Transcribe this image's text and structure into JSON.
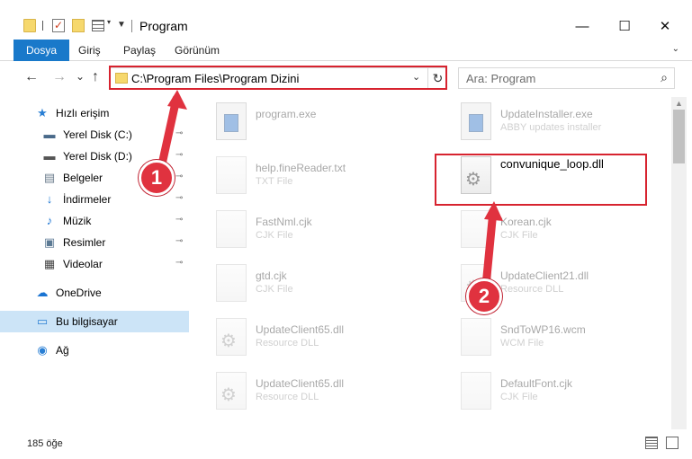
{
  "window": {
    "title": "Program",
    "minimize": "—",
    "maximize": "☐",
    "close": "✕"
  },
  "ribbon": {
    "tabs": [
      "Dosya",
      "Giriş",
      "Paylaş",
      "Görünüm"
    ],
    "expand_icon": "chevron-down-icon"
  },
  "nav": {
    "back": "←",
    "forward": "→",
    "recent": "⌄",
    "up": "↑",
    "address": "C:\\Program Files\\Program Dizini",
    "address_drop": "⌄",
    "refresh": "↻",
    "search_placeholder": "Ara: Program",
    "search_icon": "⌕"
  },
  "sidebar": {
    "items": [
      {
        "label": "Hızlı erişim",
        "icon": "★",
        "color": "#2a7fd4"
      },
      {
        "label": "Yerel Disk (C:)",
        "icon": "▬",
        "color": "#4a6a8a",
        "pinned": true
      },
      {
        "label": "Yerel Disk (D:)",
        "icon": "▬",
        "color": "#555555",
        "pinned": true
      },
      {
        "label": "Belgeler",
        "icon": "▤",
        "color": "#6b7c8c",
        "pinned": true
      },
      {
        "label": "İndirmeler",
        "icon": "↓",
        "color": "#1a74d2",
        "pinned": true
      },
      {
        "label": "Müzik",
        "icon": "♪",
        "color": "#1a74d2",
        "pinned": true
      },
      {
        "label": "Resimler",
        "icon": "▣",
        "color": "#5c7a94",
        "pinned": true
      },
      {
        "label": "Videolar",
        "icon": "▦",
        "color": "#444444",
        "pinned": true
      },
      {
        "label": "OneDrive",
        "icon": "☁",
        "color": "#1a74d2"
      },
      {
        "label": "Bu bilgisayar",
        "icon": "▭",
        "color": "#2a7fd4",
        "selected": true
      },
      {
        "label": "Ağ",
        "icon": "◉",
        "color": "#2a7fd4"
      }
    ],
    "pin_glyph": "📌"
  },
  "files": {
    "left": [
      {
        "name": "program.exe",
        "type": "",
        "icon": "app"
      },
      {
        "name": "help.fineReader.txt",
        "type": "TXT File",
        "icon": "doc"
      },
      {
        "name": "FastNml.cjk",
        "type": "CJK File",
        "icon": "doc"
      },
      {
        "name": "gtd.cjk",
        "type": "CJK File",
        "icon": "doc"
      },
      {
        "name": "UpdateClient65.dll",
        "type": "Resource DLL",
        "icon": "gear"
      },
      {
        "name": "UpdateClient65.dll",
        "type": "Resource DLL",
        "icon": "gear"
      }
    ],
    "right": [
      {
        "name": "UpdateInstaller.exe",
        "type": "ABBY updates installer",
        "icon": "app"
      },
      {
        "name": "convunique_loop.dll",
        "type": "",
        "icon": "gear",
        "focus": true
      },
      {
        "name": "Korean.cjk",
        "type": "CJK File",
        "icon": "doc"
      },
      {
        "name": "UpdateClient21.dll",
        "type": "Resource DLL",
        "icon": "gear"
      },
      {
        "name": "SndToWP16.wcm",
        "type": "WCM File",
        "icon": "doc"
      },
      {
        "name": "DefaultFont.cjk",
        "type": "CJK File",
        "icon": "doc"
      }
    ]
  },
  "status": {
    "count": "185 öğe"
  },
  "callouts": [
    "1",
    "2"
  ],
  "colors": {
    "accent": "#1979ca",
    "highlight": "#d7232f",
    "selected_bg": "#cce4f7"
  }
}
